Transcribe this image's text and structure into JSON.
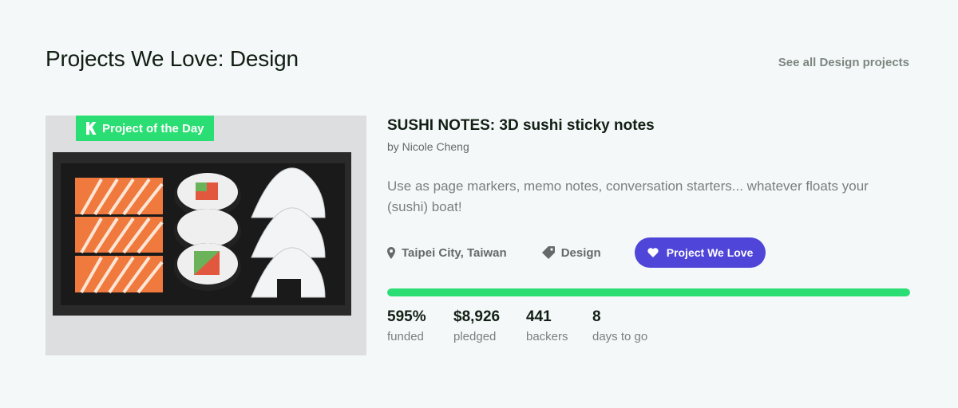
{
  "section": {
    "title": "Projects We Love: Design",
    "see_all": "See all Design projects"
  },
  "badge": {
    "label": "Project of the Day",
    "icon": "kickstarter-k-icon"
  },
  "project": {
    "title": "SUSHI NOTES: 3D sushi sticky notes",
    "byline": "by Nicole Cheng",
    "blurb": "Use as page markers, memo notes, conversation starters... whatever floats your (sushi) boat!",
    "image_alt": "Sushi shaped sticky notes in a black box"
  },
  "meta": {
    "location": "Taipei City, Taiwan",
    "location_icon": "map-pin-icon",
    "category": "Design",
    "category_icon": "tag-icon",
    "love_button": "Project We Love",
    "love_icon": "heart-icon"
  },
  "progress": {
    "funded_fraction": 1.0
  },
  "stats": [
    {
      "value": "595%",
      "label": "funded"
    },
    {
      "value": "$8,926",
      "label": "pledged"
    },
    {
      "value": "441",
      "label": "backers"
    },
    {
      "value": "8",
      "label": "days to go"
    }
  ],
  "colors": {
    "accent_green": "#2bde73",
    "love_purple": "#4f45d8",
    "background": "#f5f8f9"
  }
}
